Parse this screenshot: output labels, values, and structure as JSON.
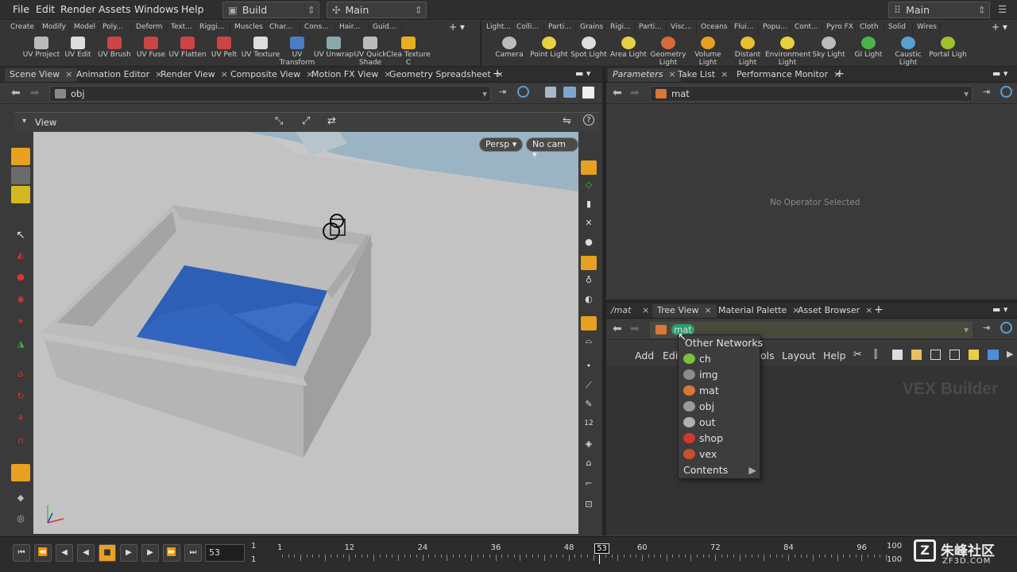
{
  "menubar": {
    "items": [
      "File",
      "Edit",
      "Render",
      "Assets",
      "Windows",
      "Help"
    ],
    "desktop": "Build",
    "context": "Main",
    "main_right": "Main"
  },
  "shelf": {
    "left_tabs": [
      "Create",
      "Modify",
      "Model",
      "Poly...",
      "Deform",
      "Text...",
      "Riggi...",
      "Muscles",
      "Char...",
      "Cons...",
      "Hair...",
      "Guid..."
    ],
    "left_tools": [
      "UV Project",
      "UV Edit",
      "UV Brush",
      "UV Fuse",
      "UV Flatten",
      "UV Pelt",
      "UV Texture",
      "UV Transform",
      "UV Unwrap",
      "UV Quick Shade",
      "Clea Texture C"
    ],
    "right_tabs": [
      "Light...",
      "Colli...",
      "Parti...",
      "Grains",
      "Rigi...",
      "Parti...",
      "Visc...",
      "Oceans",
      "Flui...",
      "Popu...",
      "Cont...",
      "Pyro FX",
      "Cloth",
      "Solid",
      "Wires"
    ],
    "right_tools": [
      "Camera",
      "Point Light",
      "Spot Light",
      "Area Light",
      "Geometry Light",
      "Volume Light",
      "Distant Light",
      "Environment Light",
      "Sky Light",
      "GI Light",
      "Caustic Light",
      "Portal Ligh"
    ]
  },
  "left_pane": {
    "tabs": [
      "Scene View",
      "Animation Editor",
      "Render View",
      "Composite View",
      "Motion FX View",
      "Geometry Spreadsheet"
    ],
    "path": "obj",
    "view_label": "View",
    "persp": "Persp",
    "cam": "No cam"
  },
  "params_pane": {
    "tabs": [
      "Parameters",
      "Take List",
      "Performance Monitor"
    ],
    "path": "mat",
    "empty_text": "No Operator Selected"
  },
  "network_pane": {
    "path_label": "/mat",
    "tabs": [
      "Tree View",
      "Material Palette",
      "Asset Browser"
    ],
    "path": "mat",
    "menu": [
      "Add",
      "Edi",
      "ols",
      "Layout",
      "Help"
    ],
    "watermark": "VEX Builder"
  },
  "context_menu": {
    "header": "Other Networks",
    "items": [
      {
        "label": "ch",
        "color": "#7cbf3a"
      },
      {
        "label": "img",
        "color": "#8c8c8c"
      },
      {
        "label": "mat",
        "color": "#d9763a"
      },
      {
        "label": "obj",
        "color": "#9a9a9a"
      },
      {
        "label": "out",
        "color": "#b0b0b0"
      },
      {
        "label": "shop",
        "color": "#d0392b"
      },
      {
        "label": "vex",
        "color": "#c8502d"
      }
    ],
    "footer": "Contents"
  },
  "timeline": {
    "current_frame": "53",
    "start": "1",
    "start2": "1",
    "end": "100",
    "end2": "100",
    "ticks": [
      "1",
      "12",
      "24",
      "36",
      "48",
      "53",
      "60",
      "72",
      "84",
      "96"
    ]
  },
  "watermark": {
    "cn": "朱峰社区",
    "url": "ZF3D.COM"
  }
}
